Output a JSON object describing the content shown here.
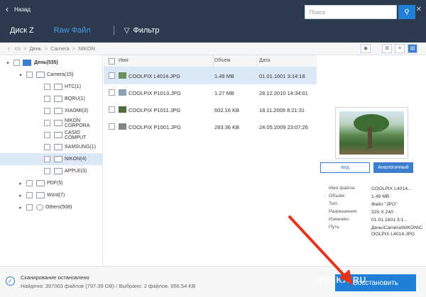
{
  "titlebar": {
    "back_label": "Назад"
  },
  "tabs": {
    "disk": "Диск Z",
    "raw": "Raw Файл",
    "filter": "Фильтр"
  },
  "search": {
    "placeholder": "Поиск"
  },
  "breadcrumb": [
    "День",
    "Camera",
    "NIKON"
  ],
  "tree": {
    "root": "День(535)",
    "camera": "Camera(15)",
    "folders": [
      "HTC(1)",
      "BQRU(1)",
      "XIAOMI(3)",
      "NIKON CORPORA",
      "CASIO COMPUT",
      "SAMSUNG(1)",
      "NIKON(4)",
      "APPLE(3)"
    ],
    "pdf": "PDF(5)",
    "word": "Word(7)",
    "others": "Others(508)"
  },
  "list": {
    "headers": {
      "name": "Имя",
      "size": "Объем",
      "date": "Дата"
    },
    "rows": [
      {
        "name": "COOLPIX L4014.JPG",
        "size": "1.49 MB",
        "date": "01.01.1601 3:14:18"
      },
      {
        "name": "COOLPIX P1013.JPG",
        "size": "1.27 MB",
        "date": "28.12.2010 14:34:01"
      },
      {
        "name": "COOLPIX P1011.JPG",
        "size": "602.16 KB",
        "date": "18.11.2008 8:21:31"
      },
      {
        "name": "COOLPIX P1001.JPG",
        "size": "283.36 KB",
        "date": "24.05.2009 23:07:26"
      }
    ]
  },
  "preview": {
    "view_btn": "вид",
    "analog_btn": "Аналогичный",
    "labels": {
      "filename": "Имя файла:",
      "size": "Объём:",
      "type": "Тип:",
      "resolution": "Разрешение:",
      "modified": "Изменён:",
      "path": "Путь"
    },
    "values": {
      "filename": "COOLPIX L4014...",
      "size": "1.49 MB",
      "type": "Файл \"JPG\"",
      "resolution": "320 X 240",
      "modified": "01.01.1601 3:1...",
      "path": "День\\Camera\\NIKON\\COOLPIX L4014.JPG"
    }
  },
  "status": {
    "line1": "Сканирование остановлено",
    "line2": "Найдено: 397003 файлов (797.39 GB) / Выбрано: 2 файлов, 656.54 KB"
  },
  "recover_label": "Восстановить",
  "watermark": "WIFIKA.RU"
}
